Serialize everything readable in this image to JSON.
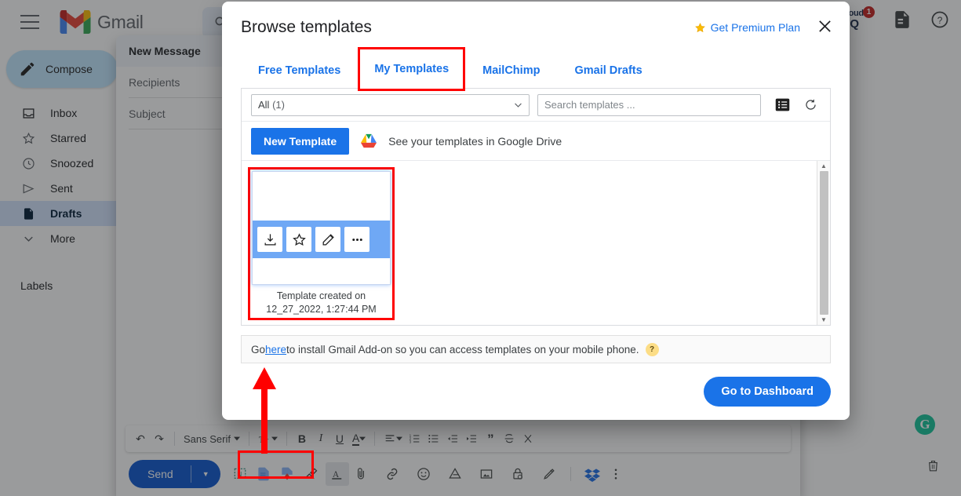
{
  "gmail": {
    "brand": "Gmail",
    "menu_icon": "hamburger-icon",
    "search_icon": "search-icon",
    "cloudhq": {
      "line1": "cloud",
      "line2": "HQ",
      "badge": "1"
    },
    "sidebar": {
      "compose_label": "Compose",
      "items": [
        {
          "label": "Inbox",
          "icon": "inbox-icon",
          "active": false
        },
        {
          "label": "Starred",
          "icon": "star-icon",
          "active": false
        },
        {
          "label": "Snoozed",
          "icon": "clock-icon",
          "active": false
        },
        {
          "label": "Sent",
          "icon": "send-icon",
          "active": false
        },
        {
          "label": "Drafts",
          "icon": "draft-icon",
          "active": true
        },
        {
          "label": "More",
          "icon": "chevron-down-icon",
          "active": false
        }
      ],
      "labels_header": "Labels"
    }
  },
  "compose": {
    "title": "New Message",
    "recipients_placeholder": "Recipients",
    "subject_placeholder": "Subject",
    "window_controls": [
      "minimize-icon",
      "fullscreen-exit-icon",
      "close-icon"
    ],
    "format_toolbar": {
      "undo": "↶",
      "redo": "↷",
      "font_name": "Sans Serif",
      "size_icon": "text-size-icon",
      "bold": "B",
      "italic": "I",
      "underline": "U",
      "text_color": "A",
      "align_icon": "align-icon",
      "numbered_list": "numbered-list-icon",
      "bulleted_list": "bulleted-list-icon",
      "indent_less": "indent-decrease-icon",
      "indent_more": "indent-increase-icon",
      "quote": "”",
      "strikethrough": "strikethrough-icon",
      "remove_format": "remove-formatting-icon"
    },
    "send_label": "Send",
    "send_options_icon": "chevron-down-icon",
    "bottom_tools": [
      "nimble-icon",
      "cloudhq-template-icon",
      "cloudhq-signature-icon",
      "cloudhq-highlighter-icon",
      "formatting-options-icon",
      "attach-file-icon",
      "insert-link-icon",
      "insert-emoji-icon",
      "insert-drive-icon",
      "insert-photo-icon",
      "confidential-mode-icon",
      "insert-signature-icon",
      "dropbox-icon",
      "more-options-icon"
    ],
    "discard_icon": "trash-icon",
    "grammarly_icon": "grammarly-icon"
  },
  "dialog": {
    "title": "Browse templates",
    "premium_label": "Get Premium Plan",
    "premium_icon": "star-icon",
    "close_icon": "close-icon",
    "tabs": [
      {
        "label": "Free Templates",
        "selected": false
      },
      {
        "label": "My Templates",
        "selected": true
      },
      {
        "label": "MailChimp",
        "selected": false
      },
      {
        "label": "Gmail Drafts",
        "selected": false
      }
    ],
    "filter": {
      "selected_option": "All",
      "selected_count": "(1)",
      "dropdown_icon": "chevron-down-icon",
      "search_placeholder": "Search templates ...",
      "list_view_icon": "list-view-icon",
      "refresh_icon": "refresh-icon"
    },
    "actions": {
      "new_template_label": "New Template",
      "drive_icon": "google-drive-icon",
      "drive_text": "See your templates in Google Drive"
    },
    "templates": [
      {
        "caption_line1": "Template created on",
        "caption_line2": "12_27_2022, 1:27:44 PM",
        "actions": [
          {
            "icon": "insert-template-icon",
            "glyph": "insert"
          },
          {
            "icon": "favorite-star-icon",
            "glyph": "star"
          },
          {
            "icon": "edit-pencil-icon",
            "glyph": "pencil"
          },
          {
            "icon": "more-options-icon",
            "glyph": "dots"
          }
        ]
      }
    ],
    "scrollbar": {
      "up_icon": "scroll-up-arrow",
      "down_icon": "scroll-down-arrow"
    },
    "addon_notice": {
      "before": "Go ",
      "link": "here",
      "after": " to install Gmail Add-on so you can access templates on your mobile phone.",
      "help_icon": "help-icon",
      "help_glyph": "?"
    },
    "footer": {
      "dashboard_label": "Go to Dashboard"
    }
  },
  "annotations": {
    "tab_highlight": "my-templates-tab-highlight",
    "card_highlight": "template-card-highlight",
    "toolbar_highlight": "compose-template-tools-highlight",
    "arrow": "pointer-arrow-up",
    "color": "#ff0000"
  }
}
